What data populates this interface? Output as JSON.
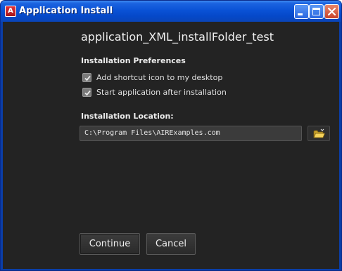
{
  "window": {
    "title": "Application Install",
    "icon": "adobe-air-icon",
    "title_bar_buttons": [
      "minimize-icon",
      "maximize-icon",
      "close-icon"
    ],
    "accent_color": "#0a52d6",
    "body_color": "#232323"
  },
  "main": {
    "app_name": "application_XML_installFolder_test",
    "preferences_heading": "Installation Preferences",
    "options": [
      {
        "label": "Add shortcut icon to my desktop",
        "checked": true
      },
      {
        "label": "Start application after installation",
        "checked": true
      }
    ],
    "location_heading": "Installation Location:",
    "location_value": "C:\\Program Files\\AIRExamples.com",
    "browse_icon": "folder-icon"
  },
  "buttons": {
    "continue_label": "Continue",
    "cancel_label": "Cancel"
  }
}
